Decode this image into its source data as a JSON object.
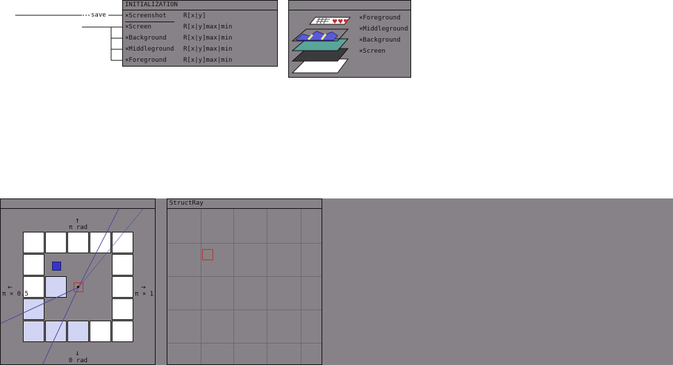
{
  "connector": {
    "save_label": "save"
  },
  "init_panel": {
    "title": "INITIALIZATION",
    "rows": [
      {
        "mark": "×",
        "name": "Screenshot",
        "format": "R[x|y]"
      },
      {
        "mark": "×",
        "name": "Screen",
        "format": "R[x|y]max|min"
      },
      {
        "mark": "×",
        "name": "Background",
        "format": "R[x|y]max|min"
      },
      {
        "mark": "×",
        "name": "Middleground",
        "format": "R[x|y]max|min"
      },
      {
        "mark": "×",
        "name": "Foreground",
        "format": "R[x|y]max|min"
      }
    ]
  },
  "layers_panel": {
    "title": "",
    "layers": [
      {
        "mark": "×",
        "name": "Foreground"
      },
      {
        "mark": "×",
        "name": "Middleground"
      },
      {
        "mark": "×",
        "name": "Background"
      },
      {
        "mark": "×",
        "name": "Screen"
      }
    ]
  },
  "map_panel": {
    "title": "",
    "up_label": "π rad",
    "down_label": "0 rad",
    "left_label": "π × 0.5",
    "right_label": "π × 1.5",
    "up_arrow": "↑",
    "down_arrow": "↓",
    "left_arrow": "←",
    "right_arrow": "→"
  },
  "ray_panel": {
    "title": "StructRay"
  },
  "colors": {
    "panel_bg": "#878287",
    "player": "#c03030",
    "target": "#3535c8",
    "visible_tile": "#d2d4f4",
    "ray": "#4a4aa0"
  }
}
